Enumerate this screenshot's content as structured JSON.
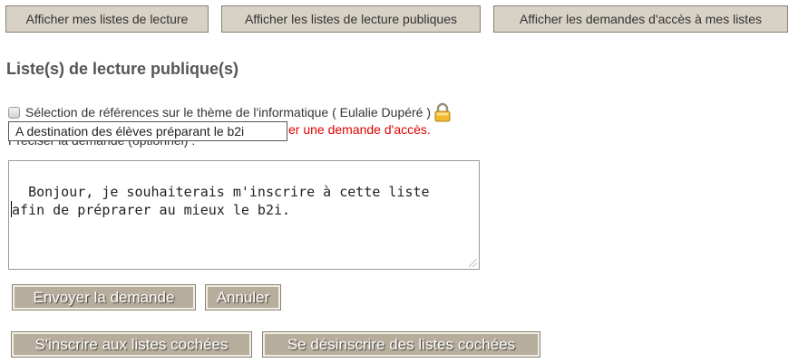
{
  "top_nav": {
    "my_lists": "Afficher mes listes de lecture",
    "public_lists": "Afficher les listes de lecture publiques",
    "access_requests": "Afficher les demandes d'accès à mes listes"
  },
  "section_title": "Liste(s) de lecture publique(s)",
  "list_item": {
    "label": "Sélection de références sur le thème de l'informatique ( Eulalie Dupéré )",
    "checked": false,
    "lock_icon": "padlock-icon"
  },
  "tooltip": "A destination des élèves préparant le b2i",
  "request_link": "er une demande d'accès.",
  "preciser_label": "Préciser la demande (optionnel) :",
  "request_text": "Bonjour, je souhaiterais m'inscrire à cette liste\nafin de préprarer au mieux le b2i.\n",
  "buttons": {
    "send": "Envoyer la demande",
    "cancel": "Annuler",
    "subscribe": "S'inscrire aux listes cochées",
    "unsubscribe": "Se désinscrire des listes cochées"
  },
  "colors": {
    "top_button_bg": "#d7d1c6",
    "action_button_bg": "#b7ad9c",
    "link_red": "#e00000"
  }
}
